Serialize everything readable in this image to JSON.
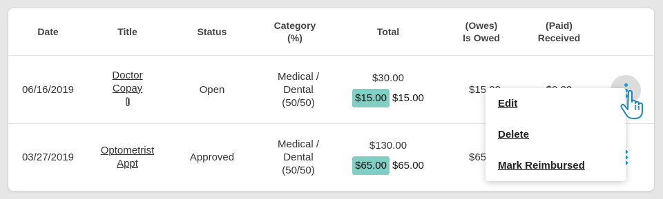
{
  "table": {
    "headers": {
      "date": "Date",
      "title": "Title",
      "status": "Status",
      "category_l1": "Category",
      "category_l2": "(%)",
      "total": "Total",
      "owes_l1": "(Owes)",
      "owes_l2": "Is Owed",
      "paid_l1": "(Paid)",
      "paid_l2": "Received"
    },
    "rows": [
      {
        "date": "06/16/2019",
        "title_l1": "Doctor",
        "title_l2": "Copay",
        "has_attachment": true,
        "status": "Open",
        "category_l1": "Medical /",
        "category_l2": "Dental",
        "category_l3": "(50/50)",
        "total_amount": "$30.00",
        "total_badge": "$15.00",
        "total_other": "$15.00",
        "owes": "$15.00",
        "paid": "$0.00"
      },
      {
        "date": "03/27/2019",
        "title_l1": "Optometrist",
        "title_l2": "Appt",
        "has_attachment": false,
        "status": "Approved",
        "category_l1": "Medical /",
        "category_l2": "Dental",
        "category_l3": "(50/50)",
        "total_amount": "$130.00",
        "total_badge": "$65.00",
        "total_other": "$65.00",
        "owes": "$65.00",
        "paid": ""
      }
    ]
  },
  "context_menu": {
    "items": [
      "Edit",
      "Delete",
      "Mark Reimbursed"
    ]
  },
  "colors": {
    "accent_dots": "#1aa0d8",
    "badge": "#7fcfc4"
  },
  "icons": {
    "attachment": "paperclip-icon",
    "more": "more-vertical-icon",
    "cursor": "hand-pointer-icon"
  }
}
